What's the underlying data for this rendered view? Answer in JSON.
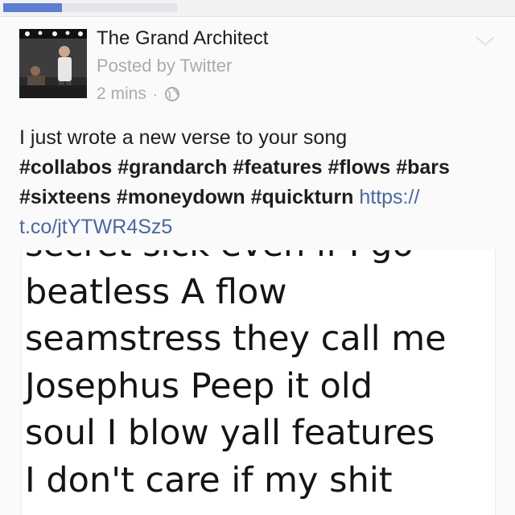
{
  "progress": {
    "value_percent": 34,
    "color": "#5b7ed2"
  },
  "post": {
    "author": "The Grand Architect",
    "source": "Posted by Twitter",
    "time": "2 mins",
    "separator": "·",
    "privacy_icon": "globe-icon",
    "menu_icon": "chevron-down-icon",
    "text_plain": "I just wrote a new verse to your song",
    "hashtags_line1": "#collabos #grandarch #features #flows #bars",
    "hashtags_line2": "#sixteens #moneydown #quickturn",
    "link_part1": "https://",
    "link_part2": "t.co/jtYTWR4Sz5",
    "link_color": "#4867aa"
  },
  "image_text": {
    "lines": [
      "secret sick even if I go",
      "beatless  A flow",
      "seamstress they call me",
      "Josephus  Peep it old",
      "soul I blow yall features",
      "I don't care if my shit"
    ]
  }
}
